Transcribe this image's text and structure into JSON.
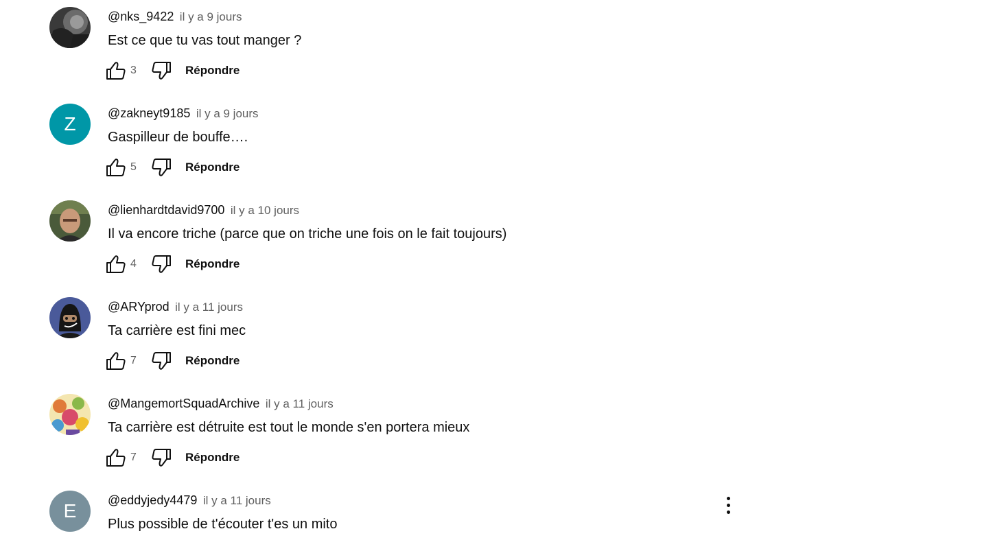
{
  "reply_label": "Répondre",
  "comments": [
    {
      "author": "@nks_9422",
      "time": "il y a 9 jours",
      "text": "Est ce que tu vas tout manger ?",
      "likes": "3",
      "avatar": {
        "type": "photo",
        "description": "dark-photo"
      }
    },
    {
      "author": "@zakneyt9185",
      "time": "il y a 9 jours",
      "text": "Gaspilleur de bouffe….",
      "likes": "5",
      "avatar": {
        "type": "letter",
        "letter": "Z",
        "color": "#0097a7"
      }
    },
    {
      "author": "@lienhardtdavid9700",
      "time": "il y a 10 jours",
      "text": "Il va encore triche (parce que on triche une fois on le fait toujours)",
      "likes": "4",
      "avatar": {
        "type": "photo",
        "description": "face-photo"
      }
    },
    {
      "author": "@ARYprod",
      "time": "il y a 11 jours",
      "text": "Ta carrière est fini mec",
      "likes": "7",
      "avatar": {
        "type": "photo",
        "description": "masked-character"
      }
    },
    {
      "author": "@MangemortSquadArchive",
      "time": "il y a 11 jours",
      "text": "Ta carrière est détruite est tout le monde s'en portera mieux",
      "likes": "7",
      "avatar": {
        "type": "photo",
        "description": "colorful-illustration"
      }
    },
    {
      "author": "@eddyjedy4479",
      "time": "il y a 11 jours",
      "text": "Plus possible de t'écouter t'es un mito",
      "likes": "",
      "avatar": {
        "type": "letter",
        "letter": "E",
        "color": "#78909c"
      }
    }
  ],
  "colors": {
    "text": "#0f0f0f",
    "secondary_text": "#606060",
    "background": "#ffffff"
  }
}
